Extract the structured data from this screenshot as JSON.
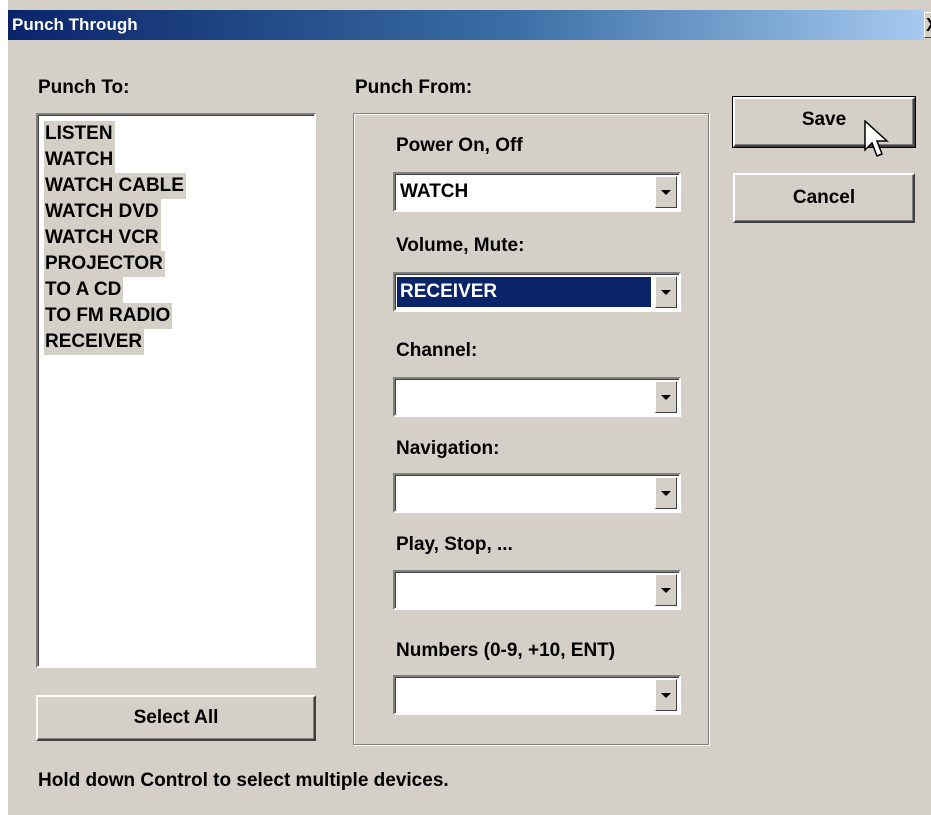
{
  "window": {
    "title": "Punch Through",
    "close_glyph": "X"
  },
  "punch_to": {
    "label": "Punch To:",
    "items": [
      "LISTEN",
      "WATCH",
      "WATCH CABLE",
      "WATCH DVD",
      "WATCH VCR",
      "PROJECTOR",
      "TO A CD",
      "TO FM RADIO",
      "RECEIVER"
    ],
    "select_all_label": "Select All"
  },
  "punch_from": {
    "label": "Punch From:",
    "fields": [
      {
        "label": "Power On, Off",
        "value": "WATCH",
        "selected": false
      },
      {
        "label": "Volume, Mute:",
        "value": "RECEIVER",
        "selected": true
      },
      {
        "label": "Channel:",
        "value": "",
        "selected": false
      },
      {
        "label": "Navigation:",
        "value": "",
        "selected": false
      },
      {
        "label": "Play, Stop, ...",
        "value": "",
        "selected": false
      },
      {
        "label": "Numbers (0-9, +10, ENT)",
        "value": "",
        "selected": false
      }
    ]
  },
  "buttons": {
    "save_label": "Save",
    "cancel_label": "Cancel"
  },
  "hint": "Hold down Control to select multiple devices.",
  "colors": {
    "face": "#d4d0c8",
    "title_start": "#0a246a",
    "selection": "#0a246a"
  },
  "icons": {
    "cursor": "arrow-cursor-icon",
    "dropdown": "chevron-down-icon"
  }
}
